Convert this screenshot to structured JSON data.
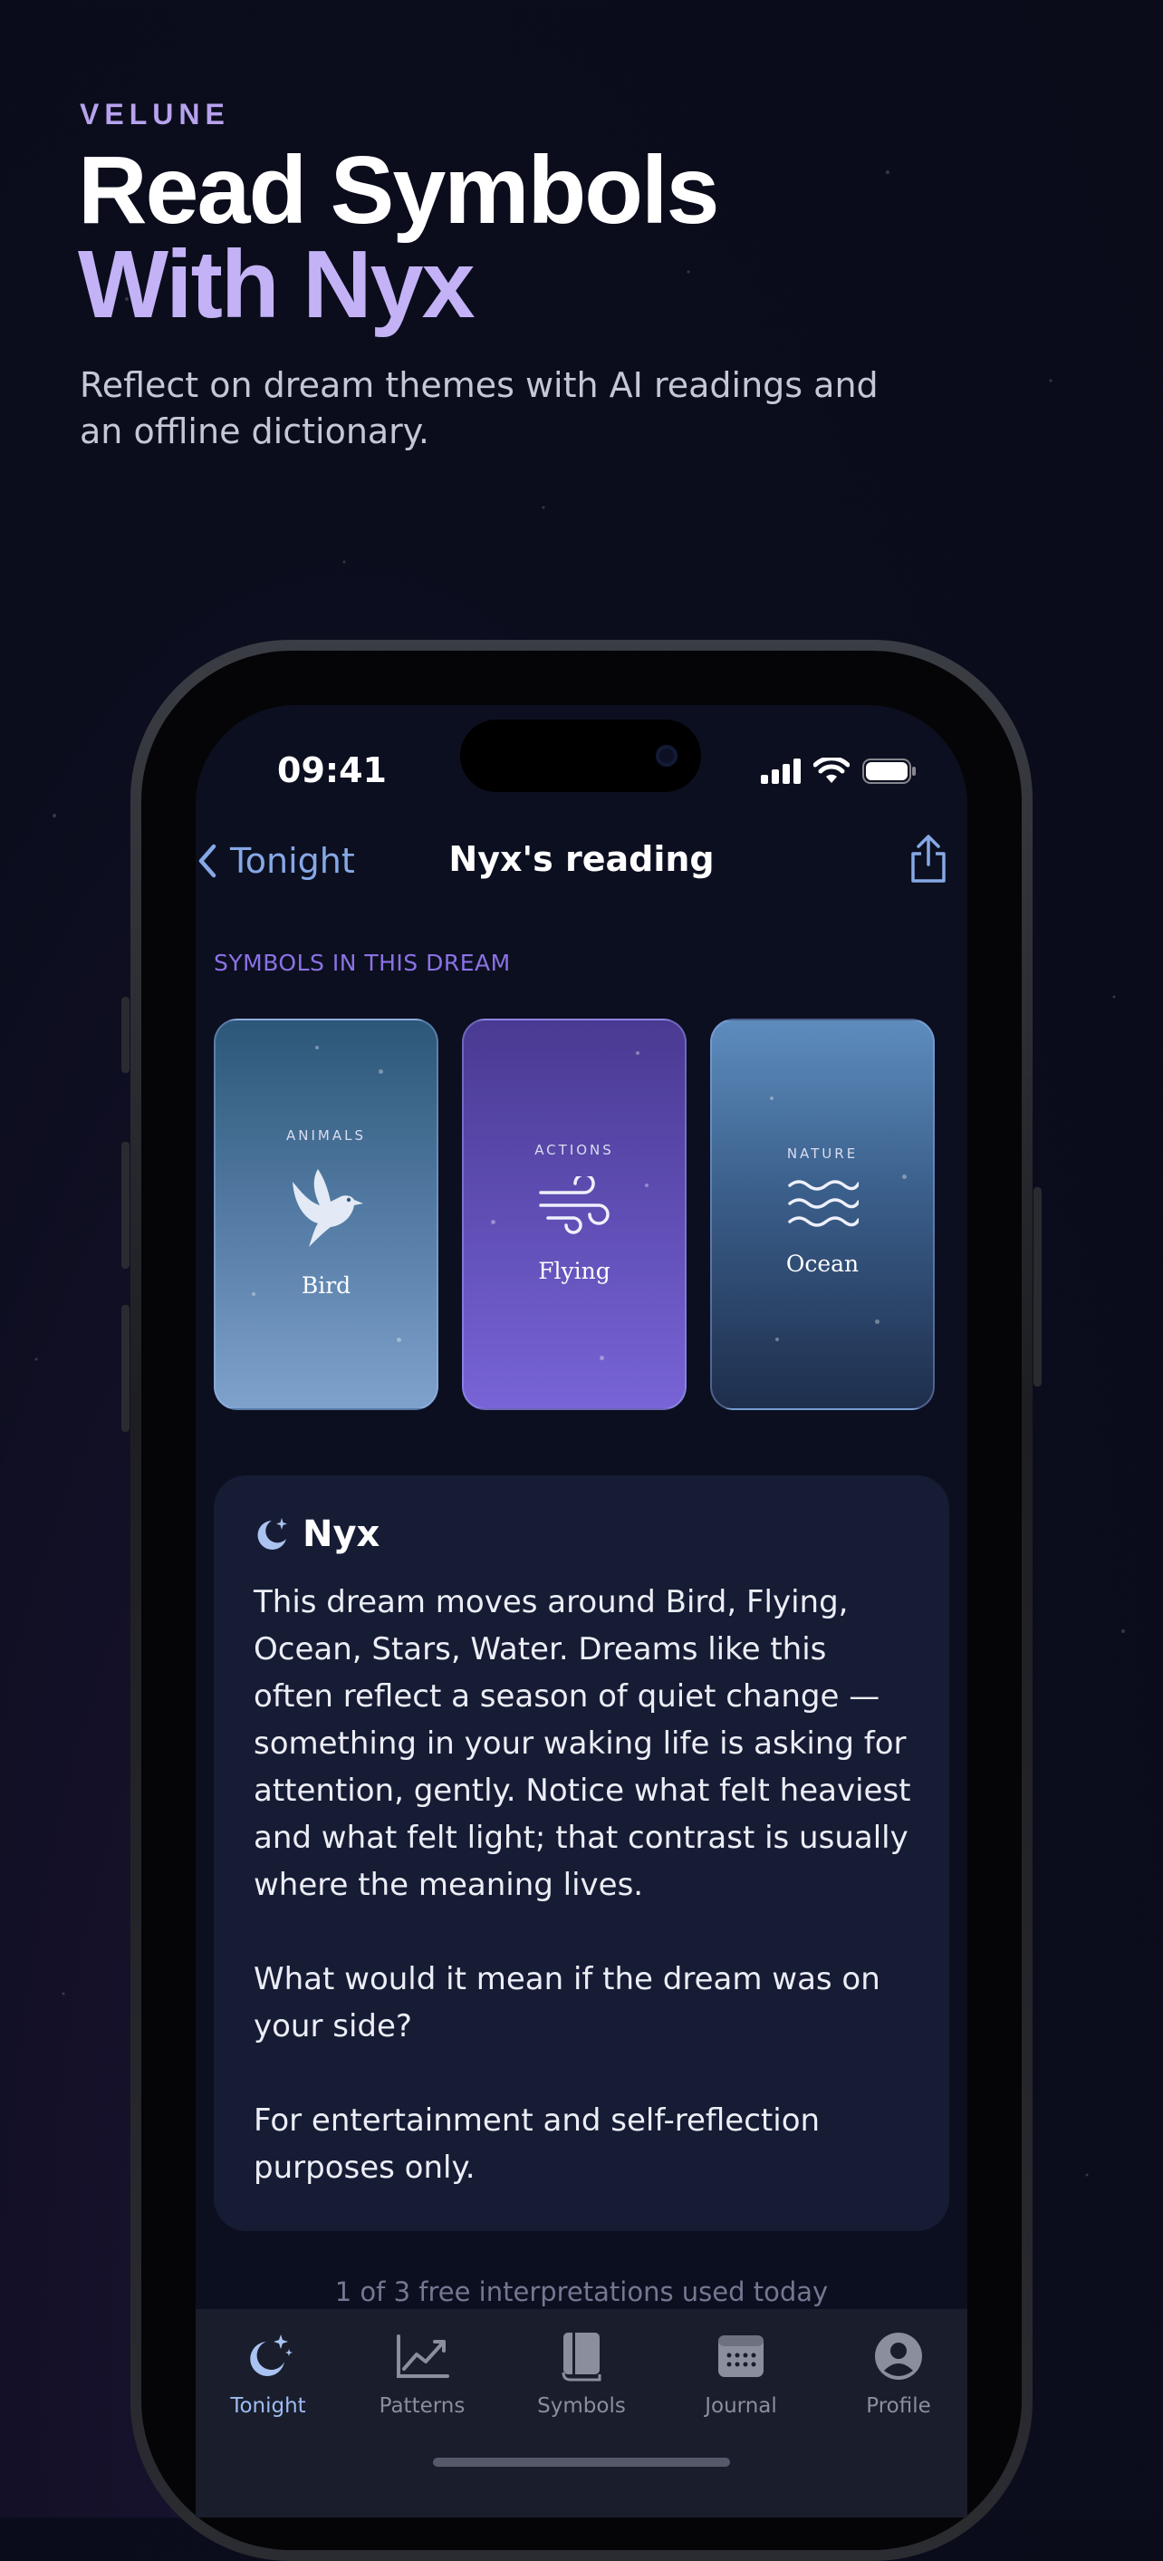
{
  "marketing": {
    "brand": "VELUNE",
    "headline_line1": "Read Symbols",
    "headline_line2": "With Nyx",
    "subheading": "Reflect on dream themes with AI readings and an offline dictionary."
  },
  "status_bar": {
    "time": "09:41"
  },
  "nav": {
    "back_label": "Tonight",
    "title": "Nyx's reading"
  },
  "symbols": {
    "section_label": "SYMBOLS IN THIS DREAM",
    "cards": [
      {
        "category": "ANIMALS",
        "name": "Bird",
        "icon": "bird-icon",
        "gradient": [
          "#2c5778",
          "#7ea2cc"
        ]
      },
      {
        "category": "ACTIONS",
        "name": "Flying",
        "icon": "wind-icon",
        "gradient": [
          "#4a3a92",
          "#7864d6"
        ]
      },
      {
        "category": "NATURE",
        "name": "Ocean",
        "icon": "waves-icon",
        "gradient": [
          "#5d8cbd",
          "#1e2e4c"
        ]
      }
    ]
  },
  "reading": {
    "author": "Nyx",
    "paragraph1": "This dream moves around Bird, Flying, Ocean, Stars, Water. Dreams like this often reflect a season of quiet change — something in your waking life is asking for attention, gently. Notice what felt heaviest and what felt light; that contrast is usually where the meaning lives.",
    "paragraph2": "What would it mean if the dream was on your side?",
    "disclaimer": "For entertainment and self-reflection purposes only."
  },
  "usage_note": "1 of 3 free interpretations used today",
  "tabbar": {
    "active": "Tonight",
    "items": [
      {
        "label": "Tonight",
        "icon": "moon-stars-icon"
      },
      {
        "label": "Patterns",
        "icon": "chart-icon"
      },
      {
        "label": "Symbols",
        "icon": "book-icon"
      },
      {
        "label": "Journal",
        "icon": "calendar-icon"
      },
      {
        "label": "Profile",
        "icon": "person-icon"
      }
    ]
  },
  "colors": {
    "accent": "#9dbcf2",
    "brand": "#b7a2ee",
    "section_label": "#8b72e6",
    "card_bg": "#171c35"
  }
}
